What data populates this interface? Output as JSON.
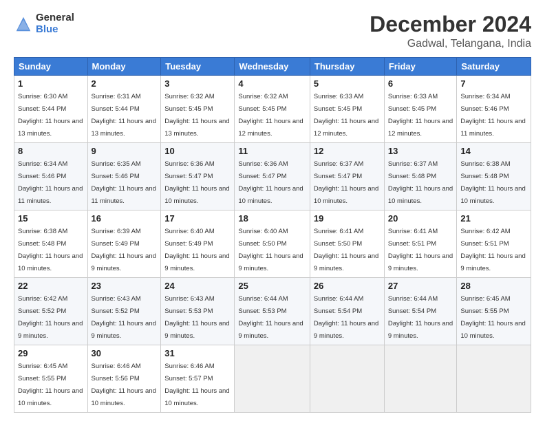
{
  "logo": {
    "general": "General",
    "blue": "Blue"
  },
  "title": "December 2024",
  "location": "Gadwal, Telangana, India",
  "weekdays": [
    "Sunday",
    "Monday",
    "Tuesday",
    "Wednesday",
    "Thursday",
    "Friday",
    "Saturday"
  ],
  "weeks": [
    [
      {
        "day": "1",
        "sunrise": "Sunrise: 6:30 AM",
        "sunset": "Sunset: 5:44 PM",
        "daylight": "Daylight: 11 hours and 13 minutes."
      },
      {
        "day": "2",
        "sunrise": "Sunrise: 6:31 AM",
        "sunset": "Sunset: 5:44 PM",
        "daylight": "Daylight: 11 hours and 13 minutes."
      },
      {
        "day": "3",
        "sunrise": "Sunrise: 6:32 AM",
        "sunset": "Sunset: 5:45 PM",
        "daylight": "Daylight: 11 hours and 13 minutes."
      },
      {
        "day": "4",
        "sunrise": "Sunrise: 6:32 AM",
        "sunset": "Sunset: 5:45 PM",
        "daylight": "Daylight: 11 hours and 12 minutes."
      },
      {
        "day": "5",
        "sunrise": "Sunrise: 6:33 AM",
        "sunset": "Sunset: 5:45 PM",
        "daylight": "Daylight: 11 hours and 12 minutes."
      },
      {
        "day": "6",
        "sunrise": "Sunrise: 6:33 AM",
        "sunset": "Sunset: 5:45 PM",
        "daylight": "Daylight: 11 hours and 12 minutes."
      },
      {
        "day": "7",
        "sunrise": "Sunrise: 6:34 AM",
        "sunset": "Sunset: 5:46 PM",
        "daylight": "Daylight: 11 hours and 11 minutes."
      }
    ],
    [
      {
        "day": "8",
        "sunrise": "Sunrise: 6:34 AM",
        "sunset": "Sunset: 5:46 PM",
        "daylight": "Daylight: 11 hours and 11 minutes."
      },
      {
        "day": "9",
        "sunrise": "Sunrise: 6:35 AM",
        "sunset": "Sunset: 5:46 PM",
        "daylight": "Daylight: 11 hours and 11 minutes."
      },
      {
        "day": "10",
        "sunrise": "Sunrise: 6:36 AM",
        "sunset": "Sunset: 5:47 PM",
        "daylight": "Daylight: 11 hours and 10 minutes."
      },
      {
        "day": "11",
        "sunrise": "Sunrise: 6:36 AM",
        "sunset": "Sunset: 5:47 PM",
        "daylight": "Daylight: 11 hours and 10 minutes."
      },
      {
        "day": "12",
        "sunrise": "Sunrise: 6:37 AM",
        "sunset": "Sunset: 5:47 PM",
        "daylight": "Daylight: 11 hours and 10 minutes."
      },
      {
        "day": "13",
        "sunrise": "Sunrise: 6:37 AM",
        "sunset": "Sunset: 5:48 PM",
        "daylight": "Daylight: 11 hours and 10 minutes."
      },
      {
        "day": "14",
        "sunrise": "Sunrise: 6:38 AM",
        "sunset": "Sunset: 5:48 PM",
        "daylight": "Daylight: 11 hours and 10 minutes."
      }
    ],
    [
      {
        "day": "15",
        "sunrise": "Sunrise: 6:38 AM",
        "sunset": "Sunset: 5:48 PM",
        "daylight": "Daylight: 11 hours and 10 minutes."
      },
      {
        "day": "16",
        "sunrise": "Sunrise: 6:39 AM",
        "sunset": "Sunset: 5:49 PM",
        "daylight": "Daylight: 11 hours and 9 minutes."
      },
      {
        "day": "17",
        "sunrise": "Sunrise: 6:40 AM",
        "sunset": "Sunset: 5:49 PM",
        "daylight": "Daylight: 11 hours and 9 minutes."
      },
      {
        "day": "18",
        "sunrise": "Sunrise: 6:40 AM",
        "sunset": "Sunset: 5:50 PM",
        "daylight": "Daylight: 11 hours and 9 minutes."
      },
      {
        "day": "19",
        "sunrise": "Sunrise: 6:41 AM",
        "sunset": "Sunset: 5:50 PM",
        "daylight": "Daylight: 11 hours and 9 minutes."
      },
      {
        "day": "20",
        "sunrise": "Sunrise: 6:41 AM",
        "sunset": "Sunset: 5:51 PM",
        "daylight": "Daylight: 11 hours and 9 minutes."
      },
      {
        "day": "21",
        "sunrise": "Sunrise: 6:42 AM",
        "sunset": "Sunset: 5:51 PM",
        "daylight": "Daylight: 11 hours and 9 minutes."
      }
    ],
    [
      {
        "day": "22",
        "sunrise": "Sunrise: 6:42 AM",
        "sunset": "Sunset: 5:52 PM",
        "daylight": "Daylight: 11 hours and 9 minutes."
      },
      {
        "day": "23",
        "sunrise": "Sunrise: 6:43 AM",
        "sunset": "Sunset: 5:52 PM",
        "daylight": "Daylight: 11 hours and 9 minutes."
      },
      {
        "day": "24",
        "sunrise": "Sunrise: 6:43 AM",
        "sunset": "Sunset: 5:53 PM",
        "daylight": "Daylight: 11 hours and 9 minutes."
      },
      {
        "day": "25",
        "sunrise": "Sunrise: 6:44 AM",
        "sunset": "Sunset: 5:53 PM",
        "daylight": "Daylight: 11 hours and 9 minutes."
      },
      {
        "day": "26",
        "sunrise": "Sunrise: 6:44 AM",
        "sunset": "Sunset: 5:54 PM",
        "daylight": "Daylight: 11 hours and 9 minutes."
      },
      {
        "day": "27",
        "sunrise": "Sunrise: 6:44 AM",
        "sunset": "Sunset: 5:54 PM",
        "daylight": "Daylight: 11 hours and 9 minutes."
      },
      {
        "day": "28",
        "sunrise": "Sunrise: 6:45 AM",
        "sunset": "Sunset: 5:55 PM",
        "daylight": "Daylight: 11 hours and 10 minutes."
      }
    ],
    [
      {
        "day": "29",
        "sunrise": "Sunrise: 6:45 AM",
        "sunset": "Sunset: 5:55 PM",
        "daylight": "Daylight: 11 hours and 10 minutes."
      },
      {
        "day": "30",
        "sunrise": "Sunrise: 6:46 AM",
        "sunset": "Sunset: 5:56 PM",
        "daylight": "Daylight: 11 hours and 10 minutes."
      },
      {
        "day": "31",
        "sunrise": "Sunrise: 6:46 AM",
        "sunset": "Sunset: 5:57 PM",
        "daylight": "Daylight: 11 hours and 10 minutes."
      },
      null,
      null,
      null,
      null
    ]
  ]
}
